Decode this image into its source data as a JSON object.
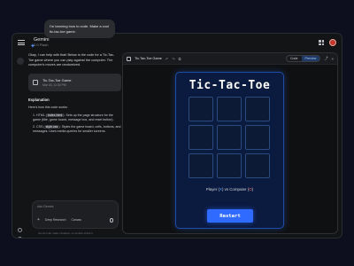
{
  "app": {
    "title": "Gemini",
    "model": "2.0 Flash"
  },
  "chat": {
    "user_message": "I'm learning how to code. Make a cool tic-tac-toe game.",
    "response_intro": "Okay, I can help with that! Below is the code for a Tic-Tac-Toe game where you can play against the computer. The computer's moves are randomized.",
    "code_card": {
      "title": "Tic-Tac-Toe Game",
      "date": "Mar 16, 11:30 PM"
    },
    "explanation_heading": "Explanation",
    "explanation_intro": "Here's how this code works:",
    "explanation_items": [
      {
        "label": "HTML (",
        "tag": "index.html",
        "text": "): Sets up the page structure for the game (title, game board, message box, and reset button)."
      },
      {
        "label": "CSS (",
        "tag": "style.css",
        "text": "): Styles the game board, cells, buttons, and messages. Uses media queries for smaller screens."
      }
    ]
  },
  "ask_box": {
    "placeholder": "Ask Gemini",
    "plus": "+",
    "deep_research": "Deep Research",
    "canvas": "Canvas"
  },
  "disclaimer": "Gemini can make mistakes, so double-check it",
  "canvas_panel": {
    "file_name": "Tic-Tac-Toe Game",
    "tool_1": "↶",
    "tool_2": "↷",
    "tool_3": "⧉",
    "code_label": "Code",
    "preview_label": "Preview",
    "share": "⤴",
    "close": "×"
  },
  "game": {
    "title": "Tic-Tac-Toe",
    "status_prefix": "Player (",
    "player_mark": "X",
    "status_mid": ") vs Computer (",
    "computer_mark": "O",
    "status_suffix": ")",
    "restart_label": "Restart",
    "board": [
      "",
      "",
      "",
      "",
      "",
      "",
      "",
      "",
      ""
    ]
  },
  "colors": {
    "accent": "#2f6bff",
    "game_bg": "#0b1a3f",
    "player": "#4ea1ff",
    "computer": "#ff6b6b"
  }
}
